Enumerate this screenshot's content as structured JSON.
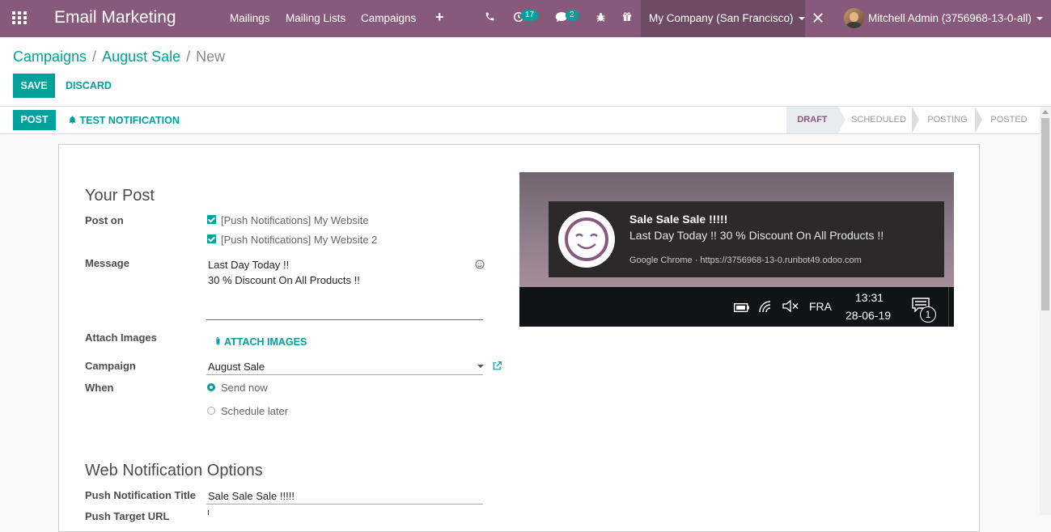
{
  "navbar": {
    "app_name": "Email Marketing",
    "menus": [
      "Mailings",
      "Mailing Lists",
      "Campaigns"
    ],
    "activity_count": "17",
    "message_count": "2",
    "company": "My Company (San Francisco)",
    "user": "Mitchell Admin (3756968-13-0-all)"
  },
  "breadcrumb": {
    "items": [
      "Campaigns",
      "August Sale"
    ],
    "current": "New"
  },
  "buttons": {
    "save": "Save",
    "discard": "Discard",
    "post": "Post",
    "test_notification": "Test Notification"
  },
  "stages": {
    "items": [
      "Draft",
      "Scheduled",
      "Posting",
      "Posted"
    ],
    "active": "Draft"
  },
  "form": {
    "section_title": "Your Post",
    "post_on_label": "Post on",
    "post_on_options": [
      {
        "label": "[Push Notifications] My Website",
        "checked": true
      },
      {
        "label": "[Push Notifications] My Website 2",
        "checked": true
      }
    ],
    "message_label": "Message",
    "message_lines": [
      "Last Day Today !!",
      "30 % Discount On All Products !!"
    ],
    "attach_images_label": "Attach Images",
    "attach_images_button": "Attach Images",
    "campaign_label": "Campaign",
    "campaign_value": "August Sale",
    "when_label": "When",
    "when_options": [
      "Send now",
      "Schedule later"
    ],
    "when_selected": "Send now",
    "web_section_title": "Web Notification Options",
    "push_title_label": "Push Notification Title",
    "push_title_value": "Sale Sale Sale !!!!!",
    "push_url_label": "Push Target URL"
  },
  "preview": {
    "title": "Sale Sale Sale !!!!!",
    "body": "Last Day Today !! 30 % Discount On All Products !!",
    "source": "Google Chrome · https://3756968-13-0.runbot49.odoo.com",
    "taskbar": {
      "language": "FRA",
      "time": "13:31",
      "date": "28-06-19",
      "notification_count": "1"
    }
  },
  "colors": {
    "navbar": "#875a7b",
    "accent": "#00a09d",
    "company_bg": "#6f4a65"
  }
}
